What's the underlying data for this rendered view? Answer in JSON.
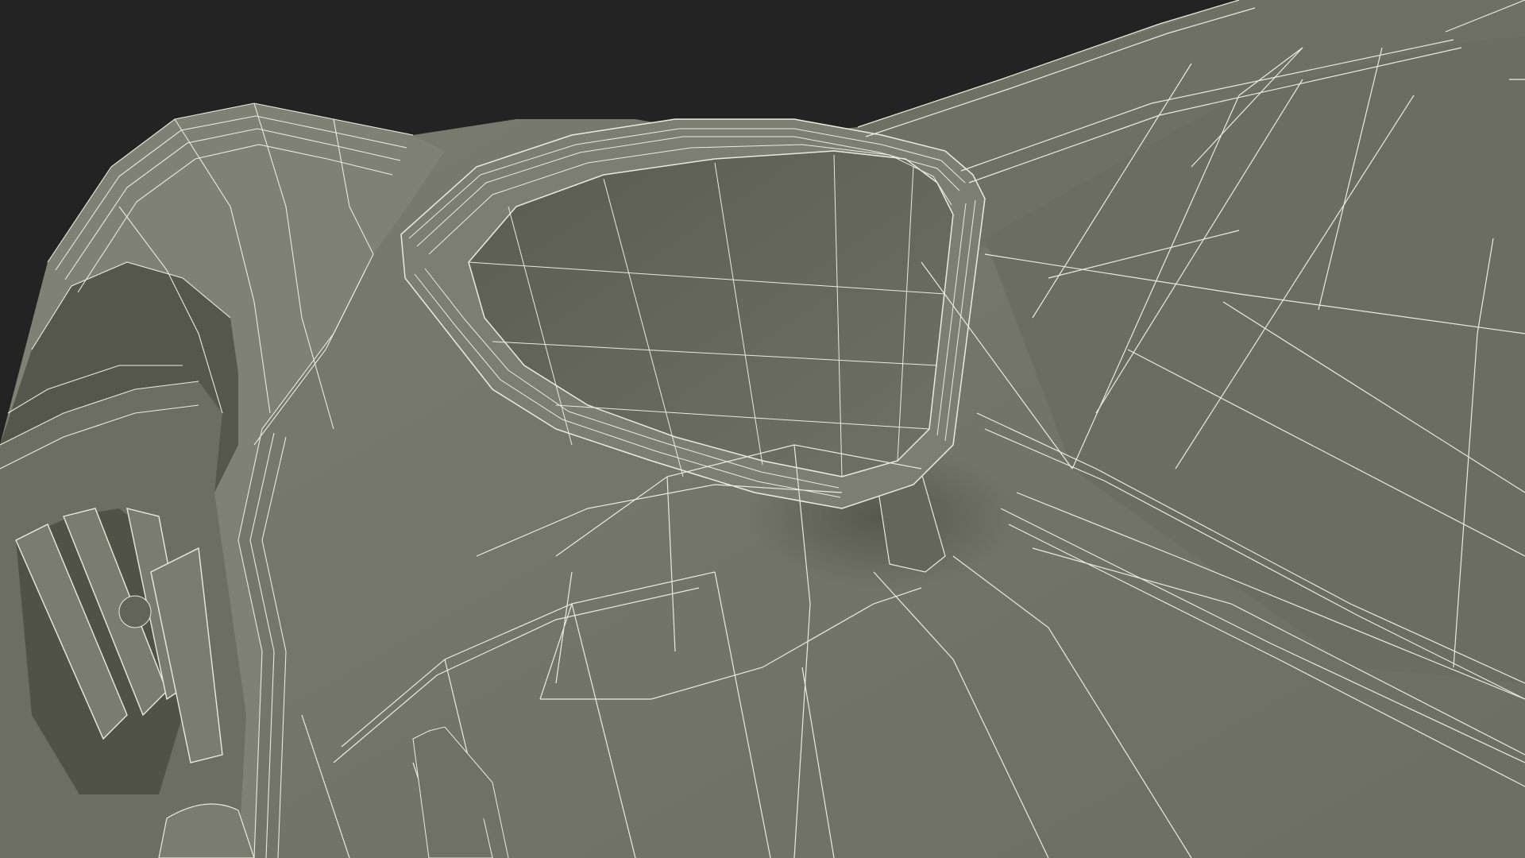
{
  "scene": {
    "subject": "wireframe-render-car-side-mirror",
    "colors": {
      "background": "#232323",
      "surface": "#74766a",
      "surface_dark": "#5a5c50",
      "surface_light": "#84867a",
      "wire": "#e9ebdc"
    }
  }
}
